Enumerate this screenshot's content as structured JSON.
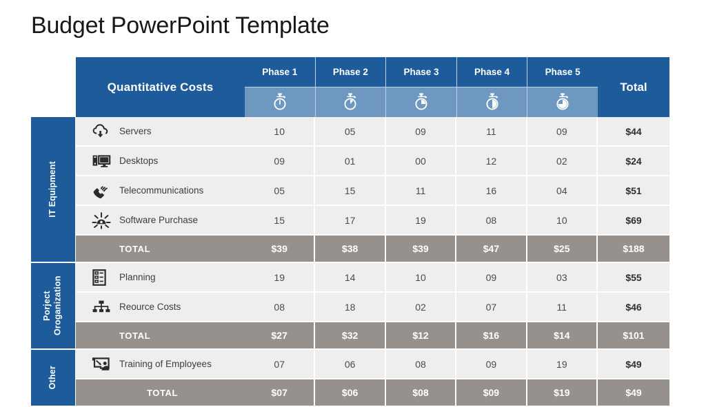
{
  "title": "Budget PowerPoint Template",
  "table": {
    "header": {
      "main_label": "Quantitative Costs",
      "total_label": "Total",
      "phases": [
        {
          "label": "Phase 1",
          "icon": "stopwatch-icon",
          "fill": 0
        },
        {
          "label": "Phase 2",
          "icon": "stopwatch-icon",
          "fill": 12
        },
        {
          "label": "Phase 3",
          "icon": "stopwatch-icon",
          "fill": 25
        },
        {
          "label": "Phase 4",
          "icon": "stopwatch-icon",
          "fill": 50
        },
        {
          "label": "Phase 5",
          "icon": "stopwatch-icon",
          "fill": 75
        }
      ]
    },
    "categories": [
      {
        "label": "IT Equipment"
      },
      {
        "label": "Porject Oroganization"
      },
      {
        "label": "Other"
      }
    ],
    "rows": [
      {
        "type": "data",
        "icon": "cloud-download-icon",
        "label": "Servers",
        "values": [
          "10",
          "05",
          "09",
          "11",
          "09"
        ],
        "total": "$44"
      },
      {
        "type": "data",
        "icon": "desktop-computer-icon",
        "label": "Desktops",
        "values": [
          "09",
          "01",
          "00",
          "12",
          "02"
        ],
        "total": "$24"
      },
      {
        "type": "data",
        "icon": "telephone-signal-icon",
        "label": "Telecommunications",
        "values": [
          "05",
          "15",
          "11",
          "16",
          "04"
        ],
        "total": "$51"
      },
      {
        "type": "data",
        "icon": "software-hub-icon",
        "label": "Software Purchase",
        "values": [
          "15",
          "17",
          "19",
          "08",
          "10"
        ],
        "total": "$69"
      },
      {
        "type": "total",
        "icon": "",
        "label": "TOTAL",
        "values": [
          "$39",
          "$38",
          "$39",
          "$47",
          "$25"
        ],
        "total": "$188"
      },
      {
        "type": "data",
        "icon": "clipboard-list-icon",
        "label": "Planning",
        "values": [
          "19",
          "14",
          "10",
          "09",
          "03"
        ],
        "total": "$55"
      },
      {
        "type": "data",
        "icon": "org-chart-icon",
        "label": "Reource Costs",
        "values": [
          "08",
          "18",
          "02",
          "07",
          "11"
        ],
        "total": "$46"
      },
      {
        "type": "total",
        "icon": "",
        "label": "TOTAL",
        "values": [
          "$27",
          "$32",
          "$12",
          "$16",
          "$14"
        ],
        "total": "$101"
      },
      {
        "type": "data",
        "icon": "training-board-icon",
        "label": "Training of Employees",
        "values": [
          "07",
          "06",
          "08",
          "09",
          "19"
        ],
        "total": "$49"
      },
      {
        "type": "total",
        "icon": "",
        "label": "TOTAL",
        "values": [
          "$07",
          "$06",
          "$08",
          "$09",
          "$19"
        ],
        "total": "$49",
        "centered": true
      }
    ]
  },
  "colors": {
    "header_blue": "#1d5b9b",
    "icon_band_blue": "#6e98c0",
    "total_row_gray": "#97918d",
    "data_row_gray": "#eeeeee",
    "title_text": "#181818"
  }
}
